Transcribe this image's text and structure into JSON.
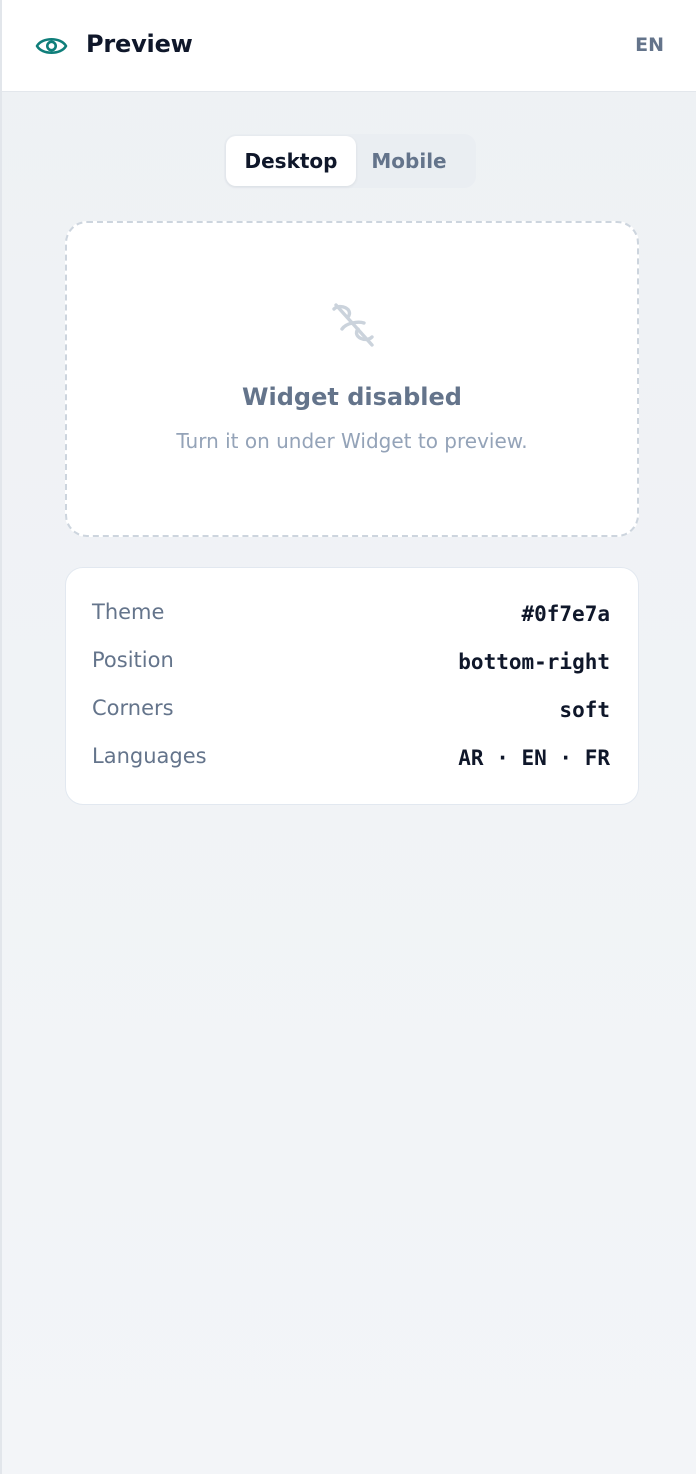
{
  "header": {
    "icon": "eye-icon",
    "title": "Preview",
    "lang_label": "EN",
    "accent_color": "#0f7e7a"
  },
  "view_tabs": [
    {
      "label": "Desktop",
      "active": true
    },
    {
      "label": "Mobile",
      "active": false
    }
  ],
  "disabled_card": {
    "icon": "link-off-icon",
    "heading": "Widget disabled",
    "message": "Turn it on under Widget to preview."
  },
  "settings": [
    {
      "label": "Theme",
      "value": "#0f7e7a"
    },
    {
      "label": "Position",
      "value": "bottom-right"
    },
    {
      "label": "Corners",
      "value": "soft"
    },
    {
      "label": "Languages",
      "value": "AR · EN · FR"
    }
  ]
}
